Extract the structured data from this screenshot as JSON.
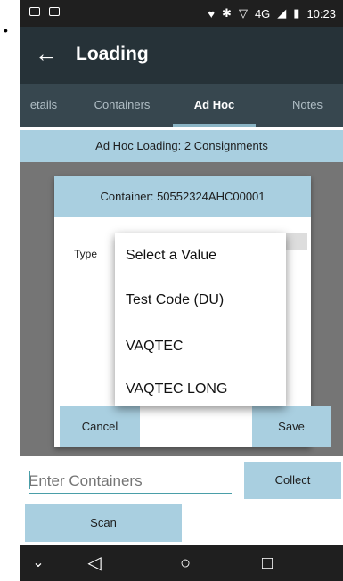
{
  "status_bar": {
    "time": "10:23",
    "network": "4G",
    "left_icons": [
      "mail-icon",
      "notification-icon"
    ],
    "right_icons": [
      "location-icon",
      "bluetooth-icon",
      "wifi-icon",
      "signal-icon",
      "battery-icon"
    ]
  },
  "app_bar": {
    "title": "Loading"
  },
  "tabs": [
    {
      "label": "etails"
    },
    {
      "label": "Containers"
    },
    {
      "label": "Ad Hoc",
      "active": true
    },
    {
      "label": "Notes"
    }
  ],
  "banner": {
    "text": "Ad Hoc Loading: 2 Consignments"
  },
  "dialog": {
    "title": "Container: 50552324AHC00001",
    "type_label": "Type",
    "cancel_label": "Cancel",
    "save_label": "Save"
  },
  "dropdown": {
    "options": [
      "Select a Value",
      "Test Code (DU)",
      "VAQTEC",
      "VAQTEC LONG"
    ]
  },
  "bottom": {
    "input_placeholder": "Enter Containers",
    "collect_label": "Collect",
    "scan_label": "Scan"
  },
  "colors": {
    "app_bar": "#263238",
    "tabs": "#37474f",
    "accent_light_blue": "#a9cfe0",
    "input_underline": "#4a9ea8"
  }
}
